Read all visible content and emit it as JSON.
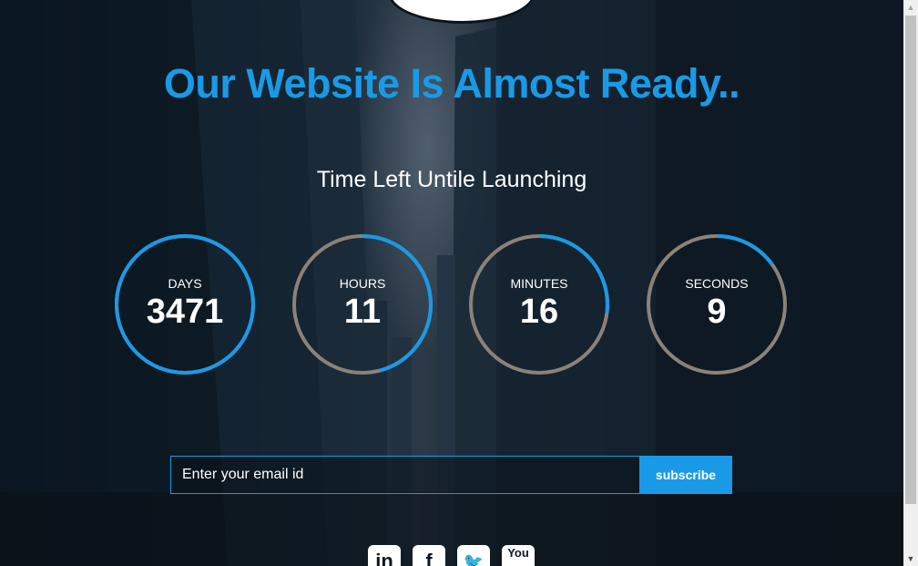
{
  "hero": {
    "title": "Our Website Is Almost Ready..",
    "subtitle": "Time Left Untile Launching"
  },
  "countdown": [
    {
      "unit": "DAYS",
      "value": "3471",
      "progress": 1.0
    },
    {
      "unit": "HOURS",
      "value": "11",
      "progress": 0.46
    },
    {
      "unit": "MINUTES",
      "value": "16",
      "progress": 0.27
    },
    {
      "unit": "SECONDS",
      "value": "9",
      "progress": 0.15
    }
  ],
  "subscribe": {
    "placeholder": "Enter your email id",
    "button_label": "subscribe"
  },
  "social": [
    {
      "icon": "linkedin-icon",
      "glyph": "in"
    },
    {
      "icon": "facebook-icon",
      "glyph": "f"
    },
    {
      "icon": "twitter-icon",
      "glyph": "🐦"
    },
    {
      "icon": "youtube-icon",
      "glyph": "You"
    }
  ],
  "colors": {
    "accent": "#1a9ae6",
    "ring_track": "#8c8278",
    "text": "#ffffff"
  }
}
